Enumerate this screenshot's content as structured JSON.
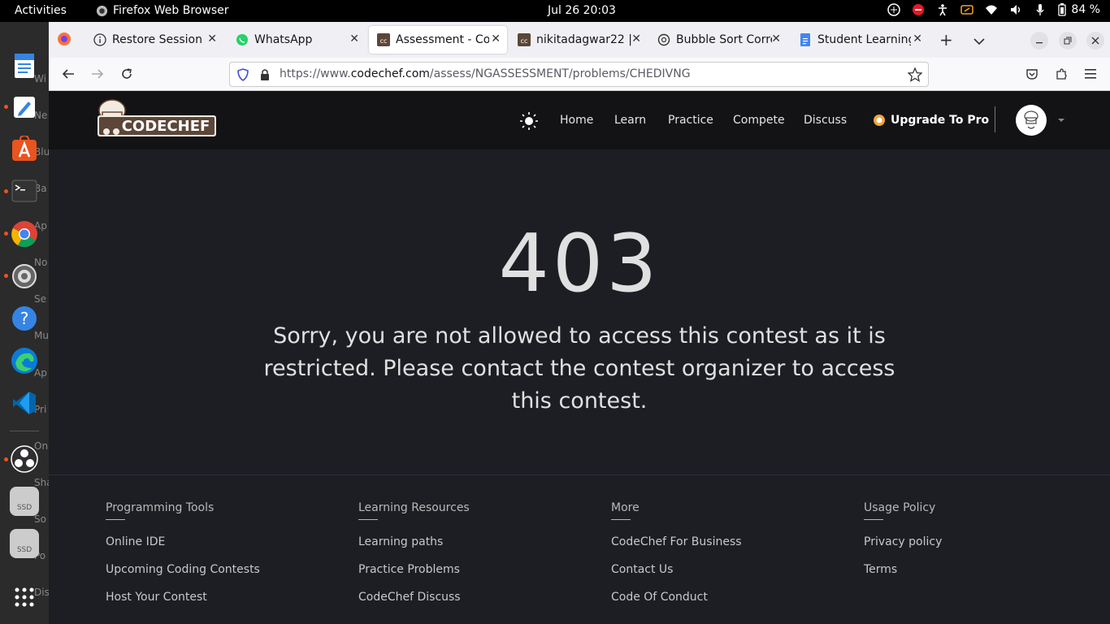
{
  "system": {
    "activities": "Activities",
    "app_name": "Firefox Web Browser",
    "clock": "Jul 26  20:03",
    "battery": "84 %"
  },
  "dock": {
    "ghost_labels": [
      "Wi",
      "Ne",
      "Blu",
      "Ba",
      "Ap",
      "No",
      "Se",
      "Mu",
      "Ap",
      "Pri",
      "On",
      "Sha",
      "So",
      "Po",
      "Dis"
    ],
    "ssd1": "SSD",
    "ssd2": "SSD"
  },
  "tabs": [
    {
      "label": "Restore Session"
    },
    {
      "label": "WhatsApp"
    },
    {
      "label": "Assessment - Cod"
    },
    {
      "label": "nikitadagwar22 |"
    },
    {
      "label": "Bubble Sort Corre"
    },
    {
      "label": "Student Learning"
    }
  ],
  "url": {
    "prefix": "https://www.",
    "domain": "codechef.com",
    "path": "/assess/NGASSESSMENT/problems/CHEDIVNG"
  },
  "site": {
    "logo_text": "CODECHEF",
    "nav": [
      "Home",
      "Learn",
      "Practice",
      "Compete",
      "Discuss"
    ],
    "upgrade": "Upgrade To Pro"
  },
  "error": {
    "code": "403",
    "message": "Sorry, you are not allowed to access this contest as it is restricted. Please contact the contest organizer to access this contest."
  },
  "footer": {
    "columns": [
      {
        "heading": "Programming Tools",
        "links": [
          "Online IDE",
          "Upcoming Coding Contests",
          "Host Your Contest"
        ]
      },
      {
        "heading": "Learning Resources",
        "links": [
          "Learning paths",
          "Practice Problems",
          "CodeChef Discuss"
        ]
      },
      {
        "heading": "More",
        "links": [
          "CodeChef For Business",
          "Contact Us",
          "Code Of Conduct"
        ]
      },
      {
        "heading": "Usage Policy",
        "links": [
          "Privacy policy",
          "Terms"
        ]
      }
    ]
  },
  "colors": {
    "page_bg": "#1d1e24",
    "header_bg": "#131316",
    "accent": "#e95420"
  }
}
